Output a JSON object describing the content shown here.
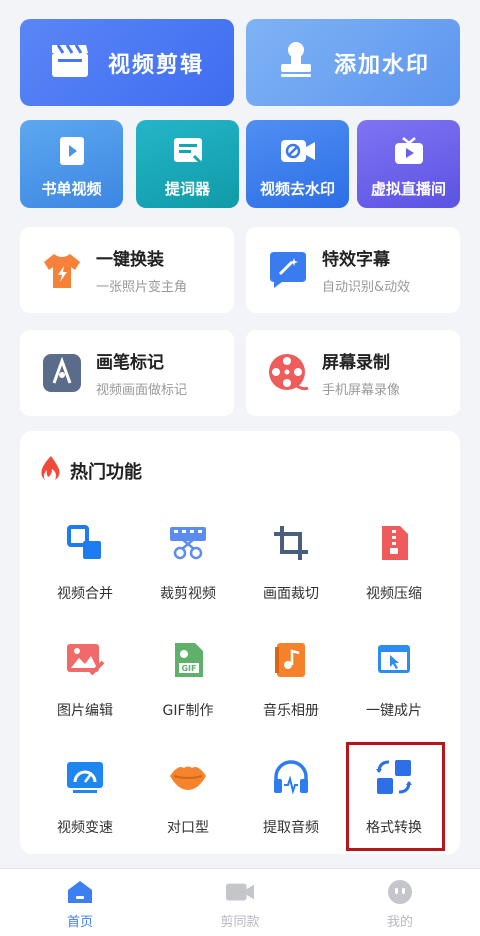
{
  "top_cards": [
    {
      "label": "视频剪辑",
      "icon": "clapperboard-icon"
    },
    {
      "label": "添加水印",
      "icon": "stamp-icon"
    }
  ],
  "small_cards": [
    {
      "label": "书单视频",
      "icon": "book-play-icon"
    },
    {
      "label": "提词器",
      "icon": "teleprompter-icon"
    },
    {
      "label": "视频去水印",
      "icon": "remove-watermark-icon"
    },
    {
      "label": "虚拟直播间",
      "icon": "tv-play-icon"
    }
  ],
  "features": [
    {
      "title": "一键换装",
      "subtitle": "一张照片变主角",
      "icon": "tshirt-icon"
    },
    {
      "title": "特效字幕",
      "subtitle": "自动识别&动效",
      "icon": "magic-subtitle-icon"
    },
    {
      "title": "画笔标记",
      "subtitle": "视频画面做标记",
      "icon": "pen-marker-icon"
    },
    {
      "title": "屏幕录制",
      "subtitle": "手机屏幕录像",
      "icon": "film-reel-icon"
    }
  ],
  "hot": {
    "title": "热门功能",
    "items": [
      {
        "label": "视频合并",
        "icon": "merge-icon"
      },
      {
        "label": "裁剪视频",
        "icon": "cut-video-icon"
      },
      {
        "label": "画面裁切",
        "icon": "crop-icon"
      },
      {
        "label": "视频压缩",
        "icon": "compress-icon"
      },
      {
        "label": "图片编辑",
        "icon": "image-edit-icon"
      },
      {
        "label": "GIF制作",
        "icon": "gif-icon"
      },
      {
        "label": "音乐相册",
        "icon": "music-album-icon"
      },
      {
        "label": "一键成片",
        "icon": "one-click-film-icon"
      },
      {
        "label": "视频变速",
        "icon": "speed-icon"
      },
      {
        "label": "对口型",
        "icon": "lips-icon"
      },
      {
        "label": "提取音频",
        "icon": "headphones-icon"
      },
      {
        "label": "格式转换",
        "icon": "convert-icon"
      }
    ]
  },
  "nav": [
    {
      "label": "首页",
      "icon": "home-icon",
      "active": true
    },
    {
      "label": "剪同款",
      "icon": "camera-icon",
      "active": false
    },
    {
      "label": "我的",
      "icon": "profile-icon",
      "active": false
    }
  ],
  "colors": {
    "accent": "#3f6df0",
    "nav_active": "#3d7ef0",
    "nav_inactive": "#b9b9c2",
    "highlight": "#b5161b"
  }
}
